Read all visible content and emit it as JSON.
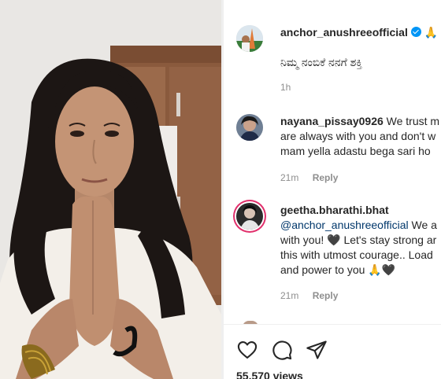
{
  "post": {
    "author": "anchor_anushreeofficial",
    "author_emoji": "🙏",
    "caption": "ನಿಮ್ಮ ನಂಬಿಕೆ ನನಗೆ ಶಕ್ತಿ",
    "time": "1h"
  },
  "comments": [
    {
      "username": "nayana_pissay0926",
      "lines": [
        "We trust m",
        "are always with you and don't w",
        "mam yella adastu bega sari ho"
      ],
      "time": "21m",
      "reply": "Reply"
    },
    {
      "username": "geetha.bharathi.bhat",
      "mention": "@anchor_anushreeofficial",
      "mention_rest": "We a",
      "lines": [
        "with you! 🖤 Let's stay strong ar",
        "this with utmost courage.. Load",
        "and power to you 🙏🖤"
      ],
      "time": "21m",
      "reply": "Reply"
    }
  ],
  "actions": {
    "views": "55,570 views"
  },
  "colors": {
    "accent_blue": "#0095f6",
    "link": "#00376b",
    "muted": "#8e8e8e",
    "story_ring": "#e1306c"
  }
}
